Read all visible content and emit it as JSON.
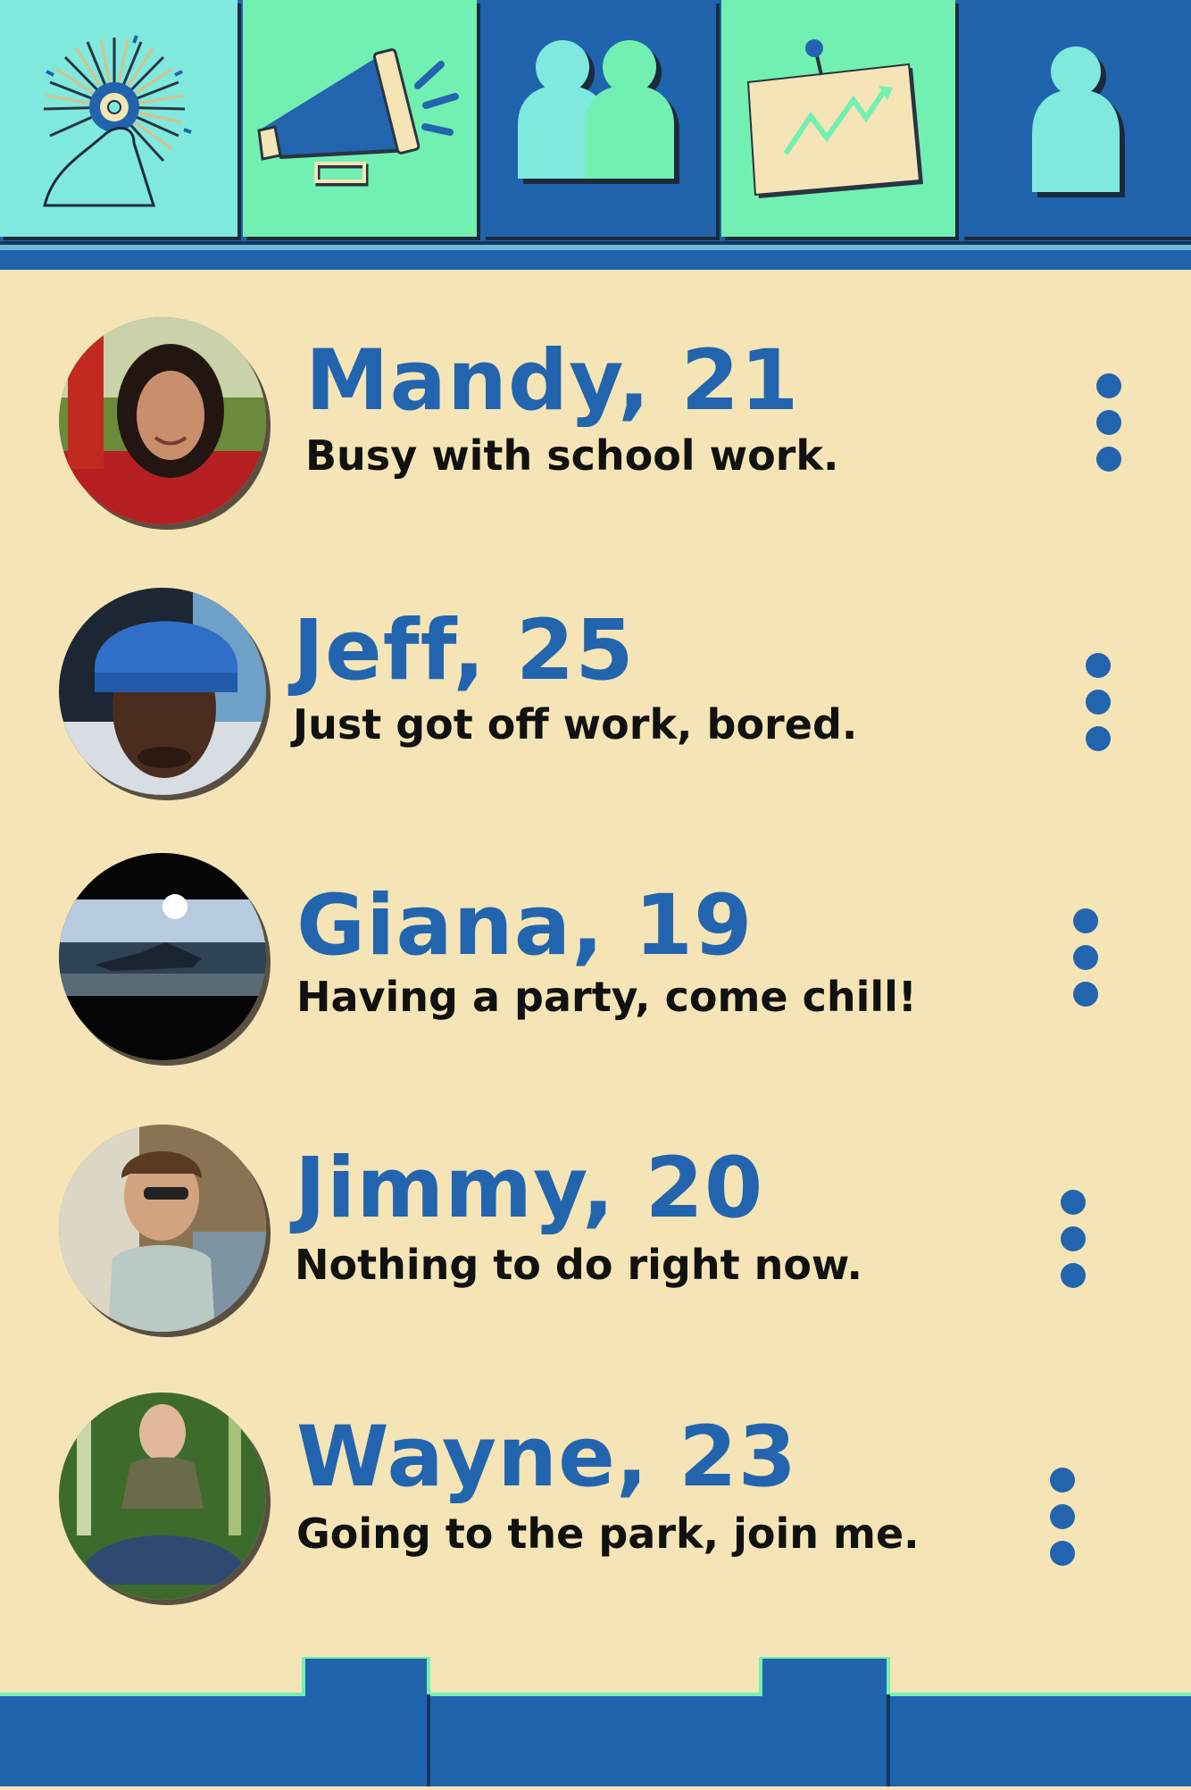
{
  "nav": {
    "tabs": [
      {
        "id": "home",
        "icon": "sunburst-logo-icon",
        "bg": "#7ee9dc"
      },
      {
        "id": "announcements",
        "icon": "megaphone-icon",
        "bg": "#72f0b1"
      },
      {
        "id": "friends",
        "icon": "people-icon",
        "bg": "#1f64ad"
      },
      {
        "id": "activity",
        "icon": "trend-board-icon",
        "bg": "#72f0b1"
      },
      {
        "id": "profile",
        "icon": "person-icon",
        "bg": "#1f64ad"
      }
    ]
  },
  "contacts": [
    {
      "name": "Mandy, 21",
      "status": "Busy with school work.",
      "avatar": "mandy-photo"
    },
    {
      "name": "Jeff, 25",
      "status": "Just got off work, bored.",
      "avatar": "jeff-photo"
    },
    {
      "name": "Giana, 19",
      "status": "Having a party, come chill!",
      "avatar": "giana-photo"
    },
    {
      "name": "Jimmy, 20",
      "status": "Nothing to do right now.",
      "avatar": "jimmy-photo"
    },
    {
      "name": "Wayne, 23",
      "status": "Going to the park, join me.",
      "avatar": "wayne-photo"
    }
  ],
  "colors": {
    "background": "#f5e4b6",
    "primary_blue": "#2265ae",
    "nav_blue": "#1f64ad",
    "mint": "#72f0b1",
    "aqua": "#7ee9dc"
  }
}
